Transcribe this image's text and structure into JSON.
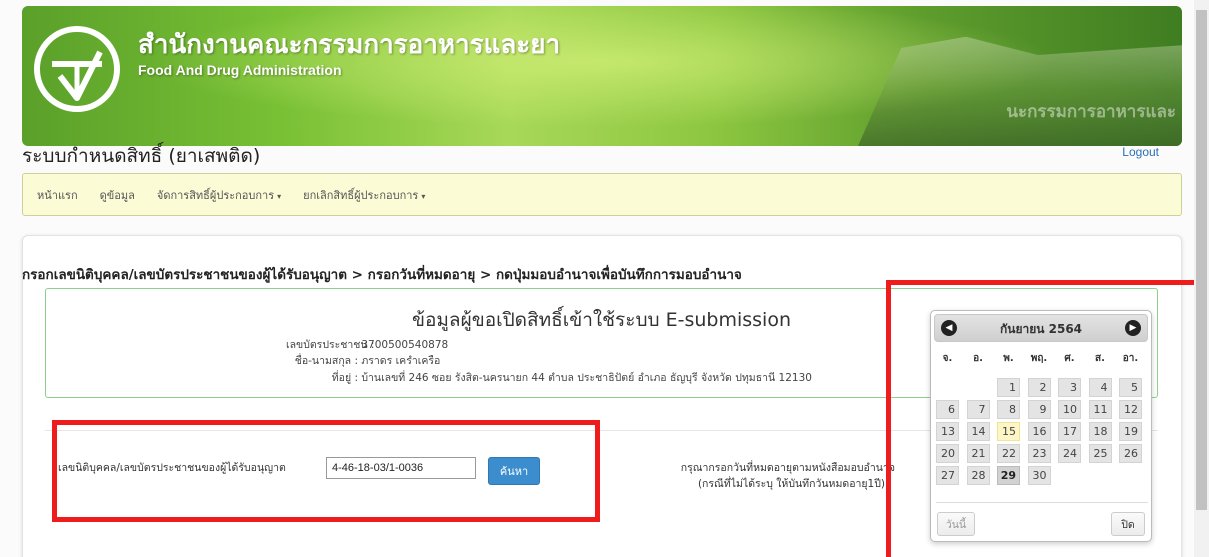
{
  "banner": {
    "org_name_th": "สำนักงานคณะกรรมการอาหารและยา",
    "org_name_en": "Food And Drug Administration",
    "building_caption": "นะกรรมการอาหารและ"
  },
  "header": {
    "system_title": "ระบบกำหนดสิทธิ์ (ยาเสพติด)",
    "logout_label": "Logout"
  },
  "nav": {
    "items": [
      {
        "label": "หน้าแรก",
        "dropdown": false
      },
      {
        "label": "ดูข้อมูล",
        "dropdown": false
      },
      {
        "label": "จัดการสิทธิ์ผู้ประกอบการ",
        "dropdown": true
      },
      {
        "label": "ยกเลิกสิทธิ์ผู้ประกอบการ",
        "dropdown": true
      }
    ],
    "caret": "▾"
  },
  "main": {
    "instructions": "กรอกเลขนิติบุคคล/เลขบัตรประชาชนของผู้ได้รับอนุญาต > กรอกวันที่หมดอายุ > กดปุ่มมอบอำนาจเพื่อบันทึกการมอบอำนาจ",
    "info": {
      "title": "ข้อมูลผู้ขอเปิดสิทธิ์เข้าใช้ระบบ E-submission",
      "id_label": "เลขบัตรประชาชน :",
      "id_value": "3700500540878",
      "name_label": "ชื่อ-นามสกุล :",
      "name_value": "ภราดร เครำเครือ",
      "address_label": "ที่อยู่ :",
      "address_value": "บ้านเลขที่ 246 ซอย รังสิต-นครนายก 44 ตำบล ประชาธิปัตย์ อำเภอ ธัญบุรี จังหวัด ปทุมธานี 12130"
    },
    "form": {
      "license_label": "เลขนิติบุคคล/เลขบัตรประชาชนของผู้ได้รับอนุญาต",
      "license_value": "4-46-18-03/1-0036",
      "search_label": "ค้นหา",
      "hint_line1": "กรุณากรอกวันที่หมดอายุตามหนังสือมอบอำนาจ",
      "hint_line2": "(กรณีที่ไม่ได้ระบุ ให้บันทึกวันหมดอายุ1ปี)"
    }
  },
  "datepicker": {
    "month_label": "กันยายน 2564",
    "prev_icon": "◀",
    "next_icon": "▶",
    "weekdays": [
      "จ.",
      "อ.",
      "พ.",
      "พฤ.",
      "ศ.",
      "ส.",
      "อา."
    ],
    "first_weekday_index": 2,
    "days_in_month": 30,
    "today": 15,
    "selected": 29,
    "today_button": "วันนี้",
    "close_button": "ปิด"
  },
  "colors": {
    "highlight_red": "#ee1c1c",
    "button_blue": "#3c8dce",
    "nav_bg": "#fbfbd6",
    "info_border": "#8cd08c"
  }
}
